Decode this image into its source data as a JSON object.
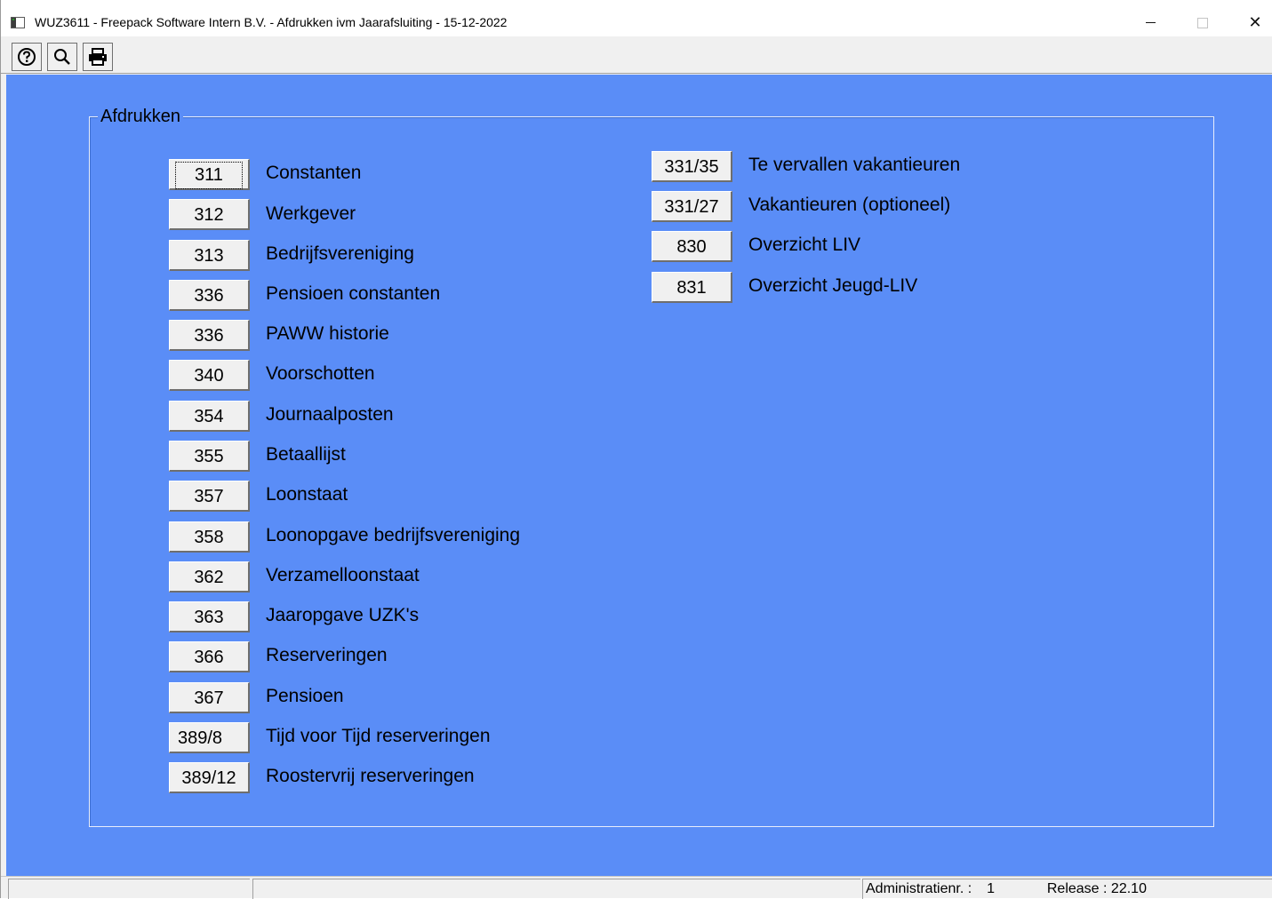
{
  "window": {
    "title": "WUZ3611  -  Freepack Software Intern B.V.  -  Afdrukken ivm Jaarafsluiting  -  15-12-2022",
    "controls": {
      "minimize_icon": "minimize-icon",
      "maximize_icon": "maximize-icon",
      "close_icon": "close-icon",
      "close_glyph": "✕"
    }
  },
  "toolbar": {
    "items": [
      {
        "name": "help-button",
        "icon": "help-circle-icon"
      },
      {
        "name": "search-button",
        "icon": "magnifier-icon"
      },
      {
        "name": "print-button",
        "icon": "printer-icon"
      }
    ]
  },
  "group": {
    "title": "Afdrukken",
    "left_items": [
      {
        "code": "311",
        "label": "Constanten"
      },
      {
        "code": "312",
        "label": "Werkgever"
      },
      {
        "code": "313",
        "label": "Bedrijfsvereniging"
      },
      {
        "code": "336",
        "label": "Pensioen constanten"
      },
      {
        "code": "336",
        "label": "PAWW historie"
      },
      {
        "code": "340",
        "label": "Voorschotten"
      },
      {
        "code": "354",
        "label": "Journaalposten"
      },
      {
        "code": "355",
        "label": "Betaallijst"
      },
      {
        "code": "357",
        "label": "Loonstaat"
      },
      {
        "code": "358",
        "label": "Loonopgave bedrijfsvereniging"
      },
      {
        "code": "362",
        "label": "Verzamelloonstaat"
      },
      {
        "code": "363",
        "label": "Jaaropgave UZK's"
      },
      {
        "code": "366",
        "label": "Reserveringen"
      },
      {
        "code": "367",
        "label": "Pensioen"
      },
      {
        "code": "389/8",
        "label": "Tijd voor Tijd reserveringen"
      },
      {
        "code": "389/12",
        "label": "Roostervrij reserveringen"
      }
    ],
    "right_items": [
      {
        "code": "331/35",
        "label": "Te vervallen vakantieuren"
      },
      {
        "code": "331/27",
        "label": "Vakantieuren (optioneel)"
      },
      {
        "code": "830",
        "label": "Overzicht LIV"
      },
      {
        "code": "831",
        "label": "Overzicht Jeugd-LIV"
      }
    ]
  },
  "statusbar": {
    "panel1": "",
    "panel2": "",
    "admin_label": "Administratienr. :",
    "admin_value": "1",
    "release_label": "Release :",
    "release_value": "22.10"
  },
  "colors": {
    "background": "#5a8df7",
    "button_face": "#f0f0f0"
  }
}
